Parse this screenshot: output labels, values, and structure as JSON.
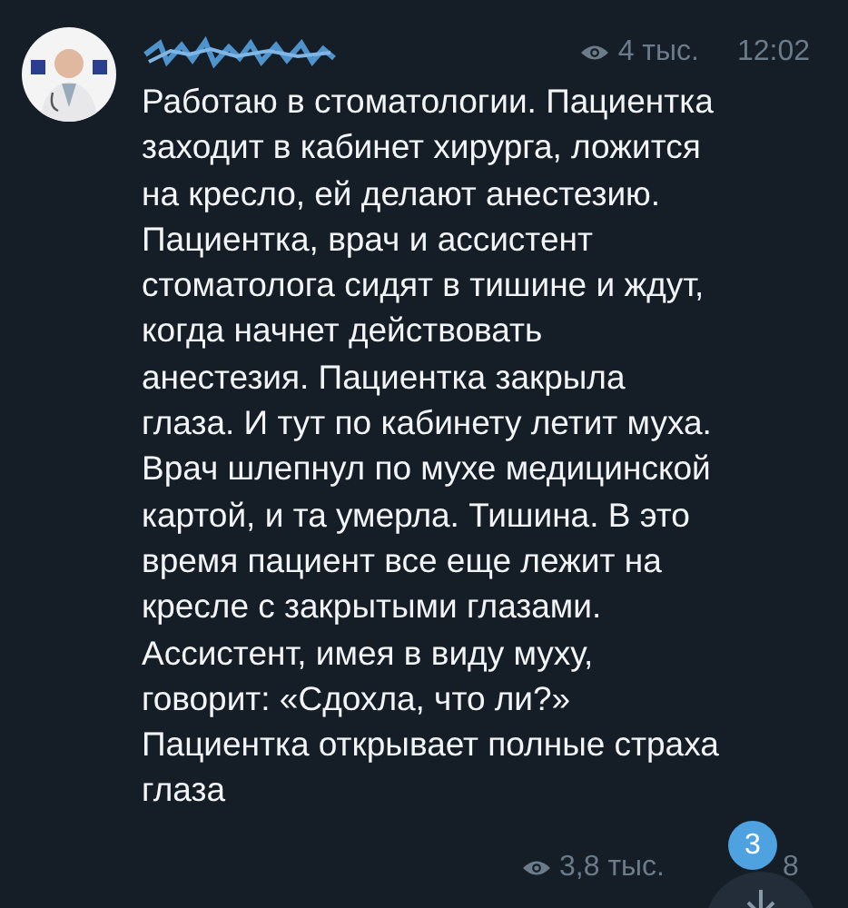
{
  "post": {
    "name_hidden": true,
    "views": "4 тыс.",
    "time": "12:02",
    "text": "Работаю в стоматологии. Пациентка\nзаходит в кабинет хирурга, ложится\nна кресло, ей делают анестезию.\nПациентка, врач и ассистент\nстоматолога сидят в тишине и ждут,\nкогда начнет действовать\nанестезия. Пациентка закрыла\nглаза. И тут по кабинету летит муха.\nВрач шлепнул по мухе медицинской\nкартой, и та умерла. Тишина. В это\nвремя пациент все еще лежит на\nкресле с закрытыми глазами.\nАссистент, имея в виду муху,\nговорит: «Сдохла, что ли?»\nПациентка открывает полные страха\nглаза"
  },
  "next_post": {
    "views": "3,8 тыс.",
    "time": "8"
  },
  "scroll_button": {
    "badge": "3"
  }
}
